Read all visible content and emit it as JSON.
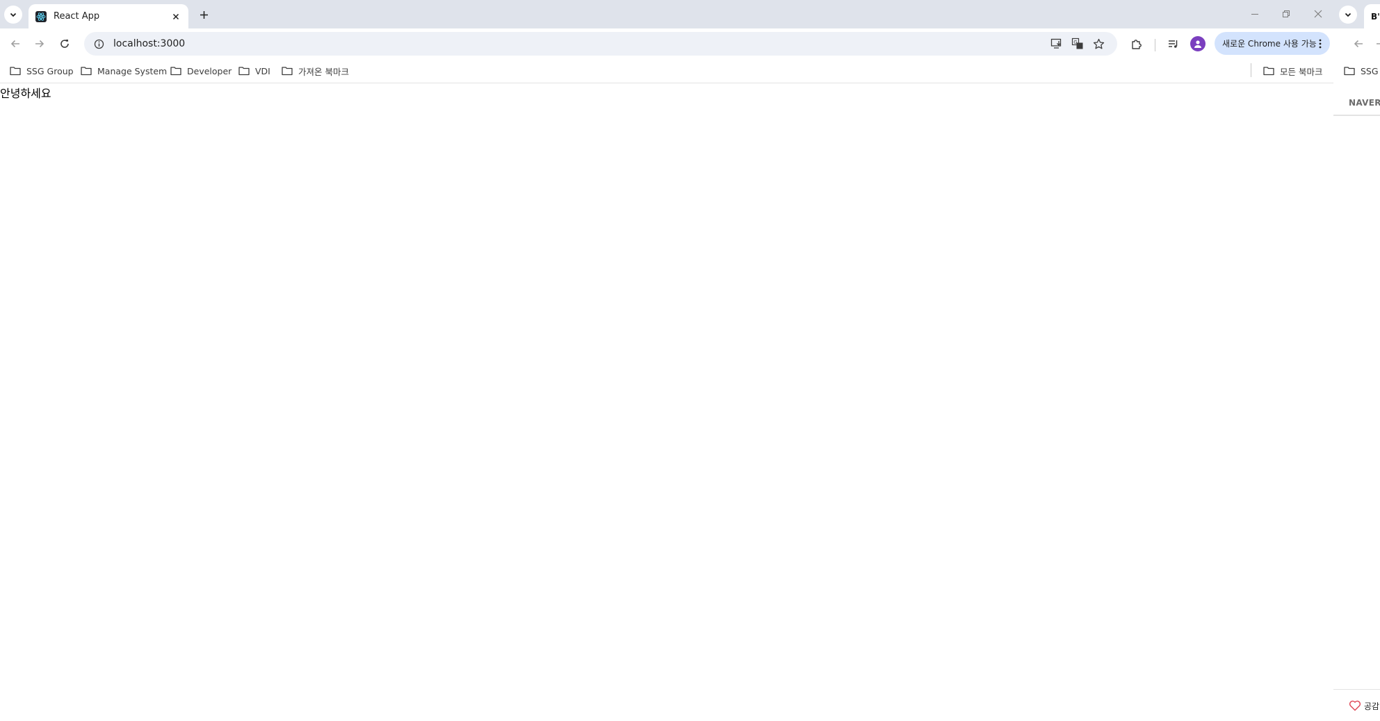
{
  "main_window": {
    "tab": {
      "title": "React App",
      "favicon": "react-icon"
    },
    "omnibox": {
      "url": "localhost:3000"
    },
    "update_chip": {
      "label": "새로운 Chrome 사용 가능"
    },
    "bookmarks": [
      {
        "label": "SSG Group",
        "icon": "folder-icon"
      },
      {
        "label": "Manage System",
        "icon": "folder-icon"
      },
      {
        "label": "Developer",
        "icon": "folder-icon"
      },
      {
        "label": "VDI",
        "icon": "folder-icon"
      },
      {
        "label": "가져온 북마크",
        "icon": "folder-icon"
      }
    ],
    "all_bookmarks": {
      "label": "모든 북마크",
      "icon": "folder-icon"
    },
    "page": {
      "greeting": "안녕하세요"
    }
  },
  "side_window": {
    "tab_favicon_text": "B'",
    "bookmark_label": "SSG",
    "naver_label": "NAVER",
    "like_label": "공감"
  },
  "colors": {
    "tabstrip": "#dfe3eb",
    "omnibox": "#eef1f7",
    "update_chip": "#d3e3fd",
    "avatar": "#7b3fbf",
    "like_heart": "#e04b5a"
  }
}
